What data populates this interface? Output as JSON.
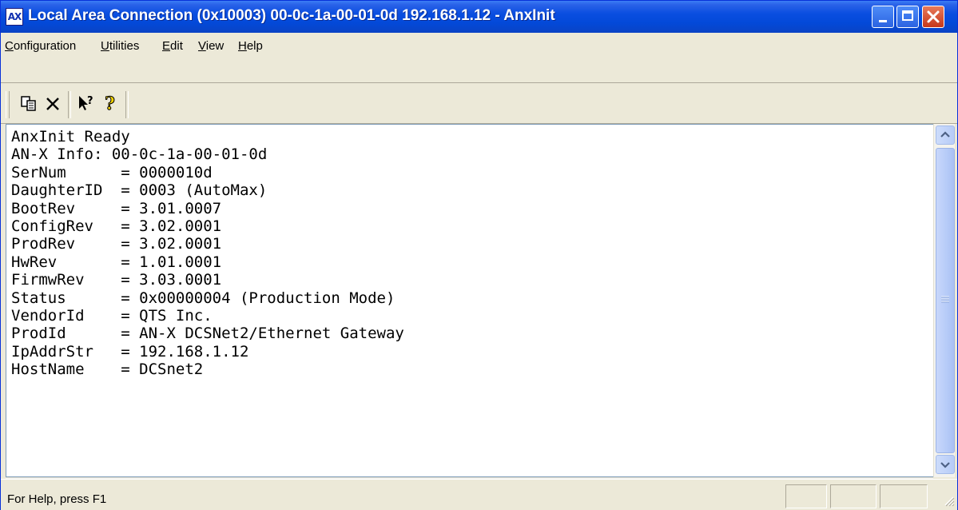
{
  "window": {
    "title": "Local Area Connection (0x10003) 00-0c-1a-00-01-0d  192.168.1.12 - AnxInit",
    "app_icon_text": "AX"
  },
  "menu": [
    {
      "label": "Configuration",
      "hotkey": "C"
    },
    {
      "label": "Utilities",
      "hotkey": "U"
    },
    {
      "label": "Edit",
      "hotkey": "E"
    },
    {
      "label": "View",
      "hotkey": "V"
    },
    {
      "label": "Help",
      "hotkey": "H"
    }
  ],
  "toolbar": {
    "icons": [
      "copy-icon",
      "delete-icon",
      "context-help-icon",
      "about-help-icon"
    ]
  },
  "output_lines": [
    "AnxInit Ready",
    "AN-X Info: 00-0c-1a-00-01-0d",
    "SerNum      = 0000010d",
    "DaughterID  = 0003 (AutoMax)",
    "BootRev     = 3.01.0007",
    "ConfigRev   = 3.02.0001",
    "ProdRev     = 3.02.0001",
    "HwRev       = 1.01.0001",
    "FirmwRev    = 3.03.0001",
    "Status      = 0x00000004 (Production Mode)",
    "VendorId    = QTS Inc.",
    "ProdId      = AN-X DCSNet2/Ethernet Gateway",
    "IpAddrStr   = 192.168.1.12",
    "HostName    = DCSnet2"
  ],
  "status": {
    "text": "For Help, press F1"
  },
  "colors": {
    "titlebar": "#0a4ee0",
    "close_button": "#c5371b",
    "window_bg": "#ece9d8"
  }
}
